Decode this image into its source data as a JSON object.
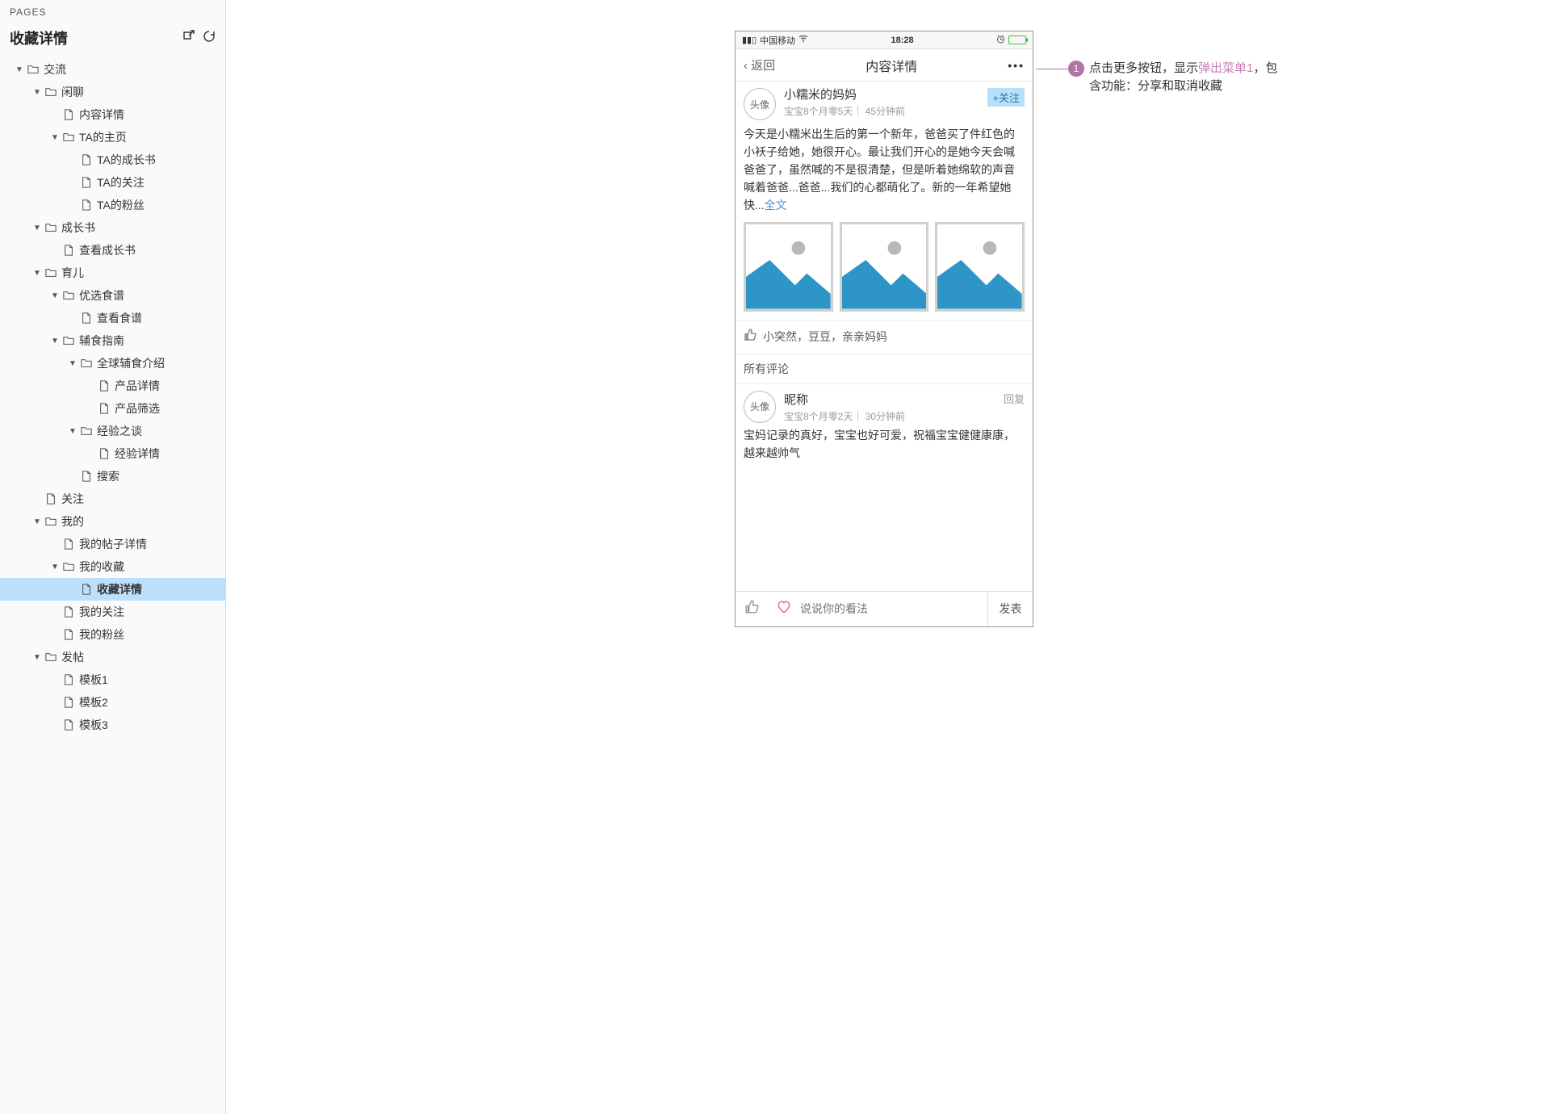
{
  "sidebar": {
    "header": "PAGES",
    "title": "收藏详情",
    "tree": [
      {
        "depth": 0,
        "kind": "folder",
        "label": "交流",
        "expanded": true
      },
      {
        "depth": 1,
        "kind": "folder",
        "label": "闲聊",
        "expanded": true
      },
      {
        "depth": 2,
        "kind": "page",
        "label": "内容详情"
      },
      {
        "depth": 2,
        "kind": "folder",
        "label": "TA的主页",
        "expanded": true
      },
      {
        "depth": 3,
        "kind": "page",
        "label": "TA的成长书"
      },
      {
        "depth": 3,
        "kind": "page",
        "label": "TA的关注"
      },
      {
        "depth": 3,
        "kind": "page",
        "label": "TA的粉丝"
      },
      {
        "depth": 1,
        "kind": "folder",
        "label": "成长书",
        "expanded": true
      },
      {
        "depth": 2,
        "kind": "page",
        "label": "查看成长书"
      },
      {
        "depth": 1,
        "kind": "folder",
        "label": "育儿",
        "expanded": true
      },
      {
        "depth": 2,
        "kind": "folder",
        "label": "优选食谱",
        "expanded": true
      },
      {
        "depth": 3,
        "kind": "page",
        "label": "查看食谱"
      },
      {
        "depth": 2,
        "kind": "folder",
        "label": "辅食指南",
        "expanded": true
      },
      {
        "depth": 3,
        "kind": "folder",
        "label": "全球辅食介绍",
        "expanded": true
      },
      {
        "depth": 4,
        "kind": "page",
        "label": "产品详情"
      },
      {
        "depth": 4,
        "kind": "page",
        "label": "产品筛选"
      },
      {
        "depth": 3,
        "kind": "folder",
        "label": "经验之谈",
        "expanded": true
      },
      {
        "depth": 4,
        "kind": "page",
        "label": "经验详情"
      },
      {
        "depth": 3,
        "kind": "page",
        "label": "搜索"
      },
      {
        "depth": 1,
        "kind": "page",
        "label": "关注"
      },
      {
        "depth": 1,
        "kind": "folder",
        "label": "我的",
        "expanded": true
      },
      {
        "depth": 2,
        "kind": "page",
        "label": "我的帖子详情"
      },
      {
        "depth": 2,
        "kind": "folder",
        "label": "我的收藏",
        "expanded": true
      },
      {
        "depth": 3,
        "kind": "page",
        "label": "收藏详情",
        "selected": true
      },
      {
        "depth": 2,
        "kind": "page",
        "label": "我的关注"
      },
      {
        "depth": 2,
        "kind": "page",
        "label": "我的粉丝"
      },
      {
        "depth": 1,
        "kind": "folder",
        "label": "发帖",
        "expanded": true
      },
      {
        "depth": 2,
        "kind": "page",
        "label": "模板1"
      },
      {
        "depth": 2,
        "kind": "page",
        "label": "模板2"
      },
      {
        "depth": 2,
        "kind": "page",
        "label": "模板3"
      }
    ]
  },
  "phone": {
    "status": {
      "carrier": "中国移动",
      "time": "18:28"
    },
    "nav": {
      "back": "返回",
      "title": "内容详情",
      "more": "•••"
    },
    "post": {
      "avatar": "头像",
      "name": "小糯米的妈妈",
      "meta": "宝宝8个月零5天｜ 45分钟前",
      "follow": "+关注",
      "body_main": "今天是小糯米出生后的第一个新年，爸爸买了件红色的小袄子给她，她很开心。最让我们开心的是她今天会喊爸爸了，虽然喊的不是很清楚，但是听着她绵软的声音喊着爸爸...爸爸...我们的心都萌化了。新的一年希望她快...",
      "body_more": "全文"
    },
    "likes": {
      "text": "小突然，豆豆，亲亲妈妈"
    },
    "comments": {
      "header": "所有评论",
      "items": [
        {
          "avatar": "头像",
          "name": "昵称",
          "meta": "宝宝8个月零2天｜ 30分钟前",
          "reply": "回复",
          "body": "宝妈记录的真好，宝宝也好可爱，祝福宝宝健健康康，越来越帅气"
        }
      ]
    },
    "input": {
      "placeholder": "说说你的看法",
      "send": "发表"
    }
  },
  "annotation": {
    "num": "1",
    "text_a": "点击更多按钮，显示",
    "link": "弹出菜单1",
    "text_b": "，包含功能：分享和取消收藏"
  }
}
